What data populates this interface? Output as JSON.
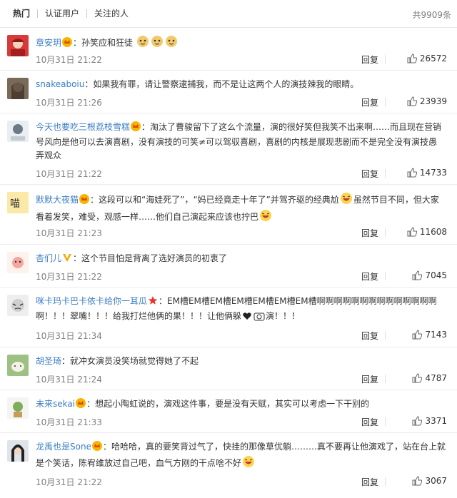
{
  "tabs": [
    {
      "label": "热门",
      "active": true
    },
    {
      "label": "认证用户",
      "active": false
    },
    {
      "label": "关注的人",
      "active": false
    }
  ],
  "total": "共9909条",
  "reply_label": "回复",
  "comments": [
    {
      "user": "章安玥",
      "badge": "crown",
      "text": "：孙笑应和狂徒",
      "emojis": [
        "doge",
        "doge",
        "doge"
      ],
      "time": "10月31日 21:22",
      "likes": "26572"
    },
    {
      "user": "snakeaboiu",
      "badge": "",
      "text": "：如果我有罪，请让警察逮捕我，而不是让这两个人的演技辣我的眼睛。",
      "emojis": [],
      "time": "10月31日 21:26",
      "likes": "23939"
    },
    {
      "user": "今天也要吃三根荔枝雪糕",
      "badge": "crown",
      "text": "：淘汰了曹骏留下了这么个流量，演的很好笑但我笑不出来啊……而且现在营销号风向是他可以去演喜剧，没有演技的可笑≠可以驾驭喜剧，喜剧的内核是展现悲剧而不是完全没有演技愚弄观众",
      "emojis": [],
      "time": "10月31日 21:22",
      "likes": "14733"
    },
    {
      "user": "默默大夜猫",
      "badge": "crown",
      "text": "：这段可以和“海娃死了”，“妈已经竟走十年了”并驾齐驱的经典尬",
      "tail": "虽然节目不同，但大家看着发笑，难受，观感一样……他们自己演起来应该也拧巴",
      "emojis": [
        "laugh"
      ],
      "emojis_tail": [
        "laugh"
      ],
      "time": "10月31日 21:23",
      "likes": "11608"
    },
    {
      "user": "杏们儿",
      "badge": "v",
      "text": "：这个节目怕是背离了选好演员的初衷了",
      "emojis": [],
      "time": "10月31日 21:22",
      "likes": "7045"
    },
    {
      "user": "咪卡玛卡巴卡依卡给你一耳瓜",
      "badge": "star",
      "text": "：EM槽EM槽EM槽EM槽EM槽EM槽EM槽啊啊啊啊啊啊啊啊啊啊啊啊啊啊啊！！！翠嘴！！！给我打烂他俩的果！！！让他俩躲",
      "tail": "演！！！",
      "emojis": [],
      "time": "10月31日 21:34",
      "likes": "7143"
    },
    {
      "user": "胡圣琦",
      "badge": "",
      "text": "：就冲女演员没笑场就觉得她了不起",
      "emojis": [],
      "time": "10月31日 21:24",
      "likes": "4787"
    },
    {
      "user": "未来sekai",
      "badge": "crown",
      "text": "：想起小陶虹说的，演戏这件事，要是没有天赋，其实可以考虑一下干别的",
      "emojis": [],
      "time": "10月31日 21:33",
      "likes": "3371"
    },
    {
      "user": "龙禹也是Sone",
      "badge": "crown",
      "text": "：哈哈哈，真的要笑背过气了，快挂的那像草优躺………真不要再让他演戏了，站在台上就是个笑话，陈宥维放过自己吧，血气方刚的干点啥不好",
      "emojis": [
        "laugh"
      ],
      "time": "10月31日 21:22",
      "likes": "3067"
    }
  ],
  "colors": {
    "username": "#eb7350",
    "meta": "#808080",
    "border": "#ececec"
  }
}
